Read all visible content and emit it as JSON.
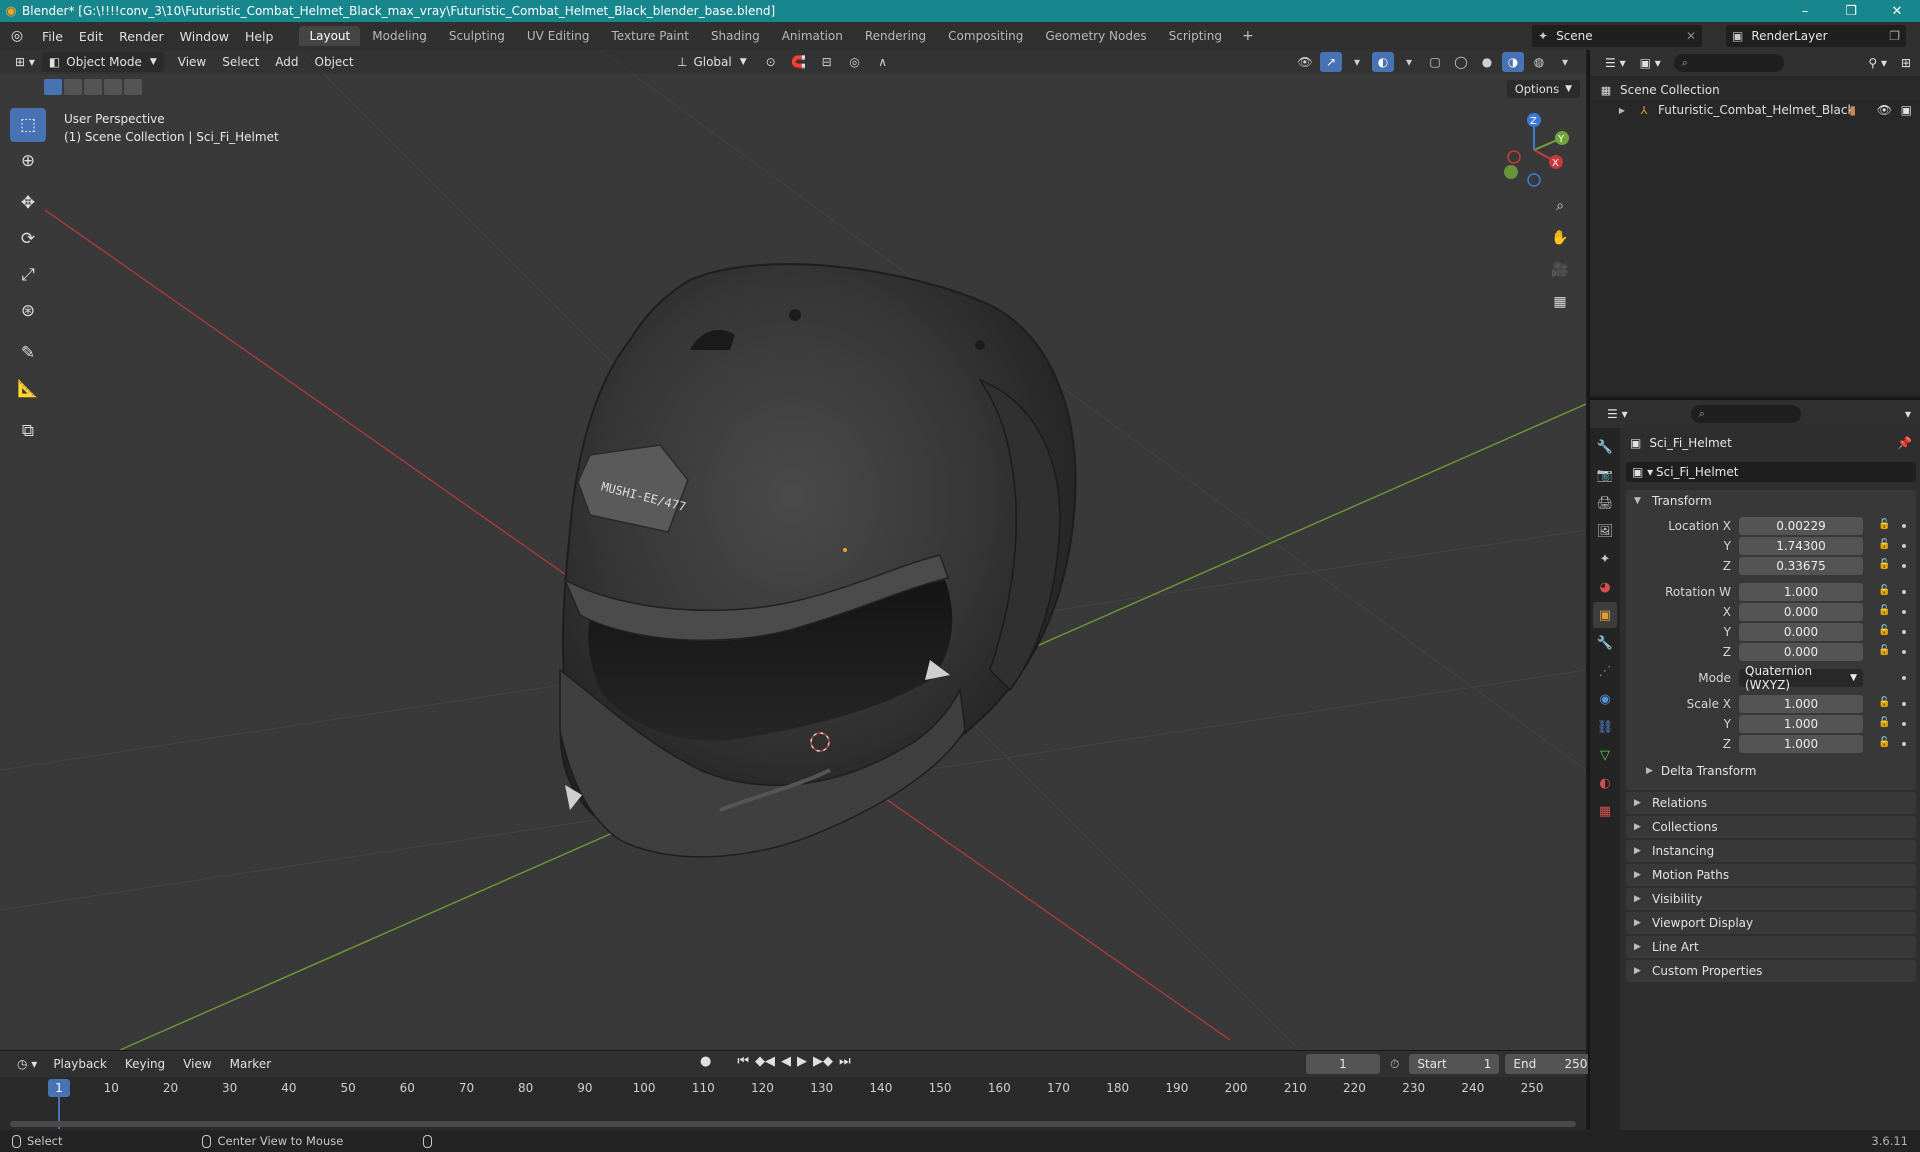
{
  "window": {
    "title": "Blender* [G:\\!!!!conv_3\\10\\Futuristic_Combat_Helmet_Black_max_vray\\Futuristic_Combat_Helmet_Black_blender_base.blend]",
    "minimize": "–",
    "maximize": "❐",
    "close": "✕"
  },
  "menu": {
    "items": [
      "File",
      "Edit",
      "Render",
      "Window",
      "Help"
    ]
  },
  "workspaces": [
    "Layout",
    "Modeling",
    "Sculpting",
    "UV Editing",
    "Texture Paint",
    "Shading",
    "Animation",
    "Rendering",
    "Compositing",
    "Geometry Nodes",
    "Scripting"
  ],
  "add_workspace": "+",
  "scene": {
    "name": "Scene",
    "render_layer": "RenderLayer"
  },
  "viewport": {
    "mode": "Object Mode",
    "menus": [
      "View",
      "Select",
      "Add",
      "Object"
    ],
    "transform_orientation": "Global",
    "options": "Options",
    "perspective": "User Perspective",
    "collection_info": "(1) Scene Collection | Sci_Fi_Helmet",
    "helmet_marking": "MUSHI-EE/477",
    "gizmo": {
      "x": "X",
      "y": "Y",
      "z": "Z"
    }
  },
  "timeline": {
    "menus": [
      "Playback",
      "Keying",
      "View",
      "Marker"
    ],
    "current_frame": "1",
    "start_label": "Start",
    "start": "1",
    "end_label": "End",
    "end": "250",
    "ticks": [
      "1",
      "10",
      "20",
      "30",
      "40",
      "50",
      "60",
      "70",
      "80",
      "90",
      "100",
      "110",
      "120",
      "130",
      "140",
      "150",
      "160",
      "170",
      "180",
      "190",
      "200",
      "210",
      "220",
      "230",
      "240",
      "250"
    ]
  },
  "statusbar": {
    "select": "Select",
    "center_view": "Center View to Mouse",
    "version": "3.6.11"
  },
  "outliner": {
    "scene_collection": "Scene Collection",
    "object": "Futuristic_Combat_Helmet_Black"
  },
  "properties": {
    "object_name": "Sci_Fi_Helmet",
    "object_field": "Sci_Fi_Helmet",
    "transform_title": "Transform",
    "location": {
      "label": "Location X",
      "x": "0.00229",
      "y_label": "Y",
      "y": "1.74300",
      "z_label": "Z",
      "z": "0.33675"
    },
    "rotation": {
      "label": "Rotation W",
      "w": "1.000",
      "x_label": "X",
      "x": "0.000",
      "y_label": "Y",
      "y": "0.000",
      "z_label": "Z",
      "z": "0.000"
    },
    "mode_label": "Mode",
    "mode_value": "Quaternion (WXYZ)",
    "scale": {
      "label": "Scale X",
      "x": "1.000",
      "y_label": "Y",
      "y": "1.000",
      "z_label": "Z",
      "z": "1.000"
    },
    "delta_transform": "Delta Transform",
    "panels": [
      "Relations",
      "Collections",
      "Instancing",
      "Motion Paths",
      "Visibility",
      "Viewport Display",
      "Line Art",
      "Custom Properties"
    ]
  },
  "colors": {
    "accent": "#4772b3",
    "titlebar": "#17868d",
    "x_axis": "#c8393d",
    "y_axis": "#72a33a",
    "z_axis": "#3b7ad6"
  }
}
